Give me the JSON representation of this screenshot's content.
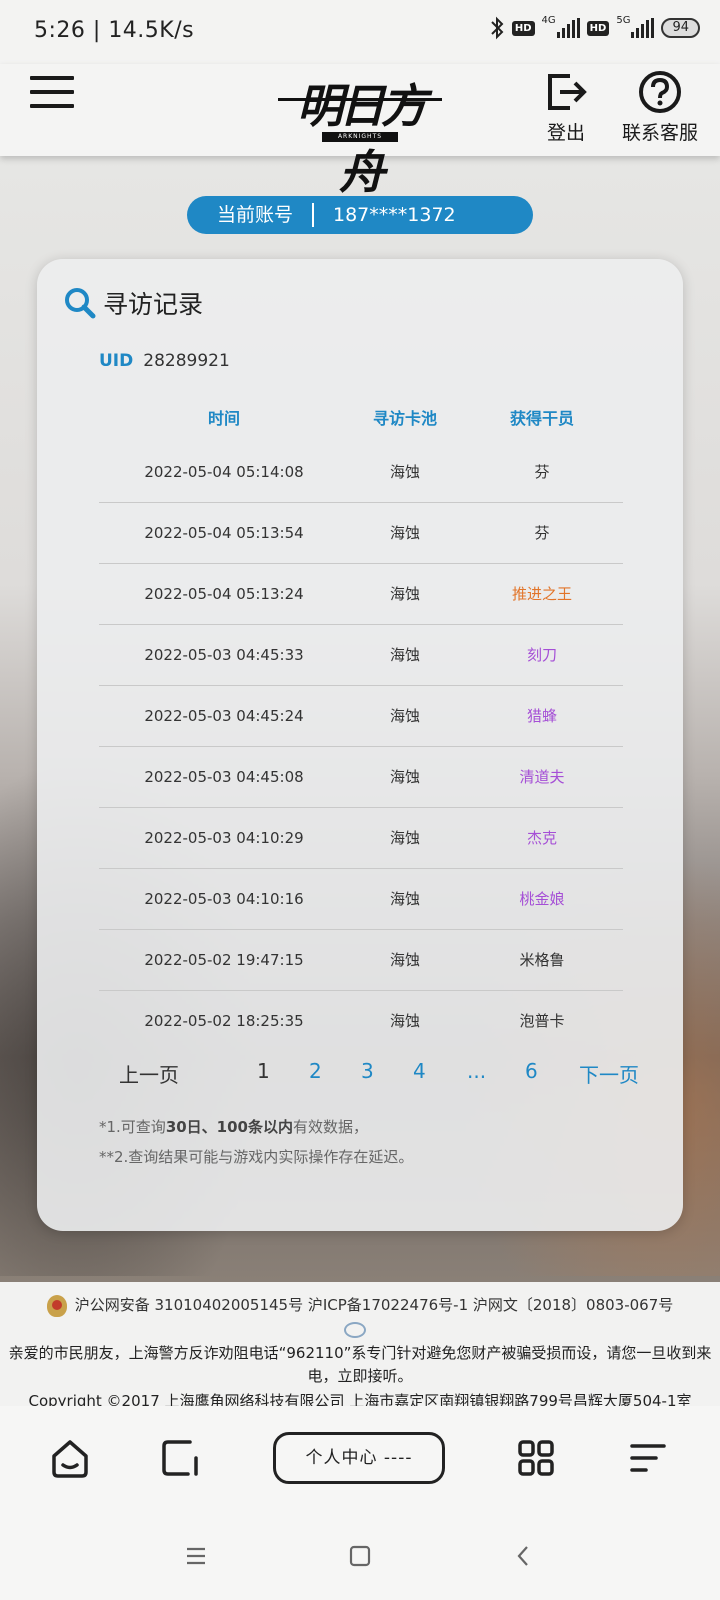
{
  "status_bar": {
    "time": "5:26",
    "speed": "14.5K/s",
    "net1_badge": "HD",
    "net1_type": "4G",
    "net2_badge": "HD",
    "net2_type": "5G",
    "battery": "94"
  },
  "header": {
    "logo_text": "明日方舟",
    "logo_sub": "ARKNIGHTS",
    "logout_label": "登出",
    "support_label": "联系客服"
  },
  "account": {
    "label": "当前账号",
    "value": "187****1372"
  },
  "card": {
    "title": "寻访记录",
    "uid_label": "UID",
    "uid_value": "28289921",
    "columns": [
      "时间",
      "寻访卡池",
      "获得干员"
    ],
    "rows": [
      {
        "time": "2022-05-04 05:14:08",
        "pool": "海蚀",
        "operator": "芬"
      },
      {
        "time": "2022-05-04 05:13:54",
        "pool": "海蚀",
        "operator": "芬"
      },
      {
        "time": "2022-05-04 05:13:24",
        "pool": "海蚀",
        "operator": "推进之王"
      },
      {
        "time": "2022-05-03 04:45:33",
        "pool": "海蚀",
        "operator": "刻刀"
      },
      {
        "time": "2022-05-03 04:45:24",
        "pool": "海蚀",
        "operator": "猎蜂"
      },
      {
        "time": "2022-05-03 04:45:08",
        "pool": "海蚀",
        "operator": "清道夫"
      },
      {
        "time": "2022-05-03 04:10:29",
        "pool": "海蚀",
        "operator": "杰克"
      },
      {
        "time": "2022-05-03 04:10:16",
        "pool": "海蚀",
        "operator": "桃金娘"
      },
      {
        "time": "2022-05-02 19:47:15",
        "pool": "海蚀",
        "operator": "米格鲁"
      },
      {
        "time": "2022-05-02 18:25:35",
        "pool": "海蚀",
        "operator": "泡普卡"
      }
    ],
    "pagination": {
      "prev": "上一页",
      "current": "1",
      "pages": [
        "2",
        "3",
        "4"
      ],
      "ellipsis": "...",
      "last": "6",
      "next": "下一页"
    },
    "note1_prefix": "*1.可查询",
    "note1_bold": "30日、100条以内",
    "note1_suffix": "有效数据，",
    "note2": "**2.查询结果可能与游戏内实际操作存在延迟。"
  },
  "colors": {
    "accent": "#1f88c5",
    "rarity_6": "#e2752a",
    "rarity_4": "#a54fd6",
    "rarity_3": "#333333"
  },
  "footer": {
    "license": "沪公网安备 31010402005145号  沪ICP备17022476号-1  沪网文〔2018〕0803-067号",
    "notice": "亲爱的市民朋友，上海警方反诈劝阻电话“962110”系专门针对避免您财产被骗受损而设，请您一旦收到来电，立即接听。",
    "copyright": "Copyright ©2017 上海鹰角网络科技有限公司  上海市嘉定区南翔镇银翔路799号昌辉大厦504-1室"
  },
  "toolbar": {
    "center_label": "个人中心 ----",
    "icons": [
      "home-icon",
      "tab-switch-icon",
      "apps-grid-icon",
      "menu-lines-icon"
    ]
  },
  "navbar": {
    "icons": [
      "recent-apps-icon",
      "home-square-icon",
      "back-icon"
    ]
  }
}
